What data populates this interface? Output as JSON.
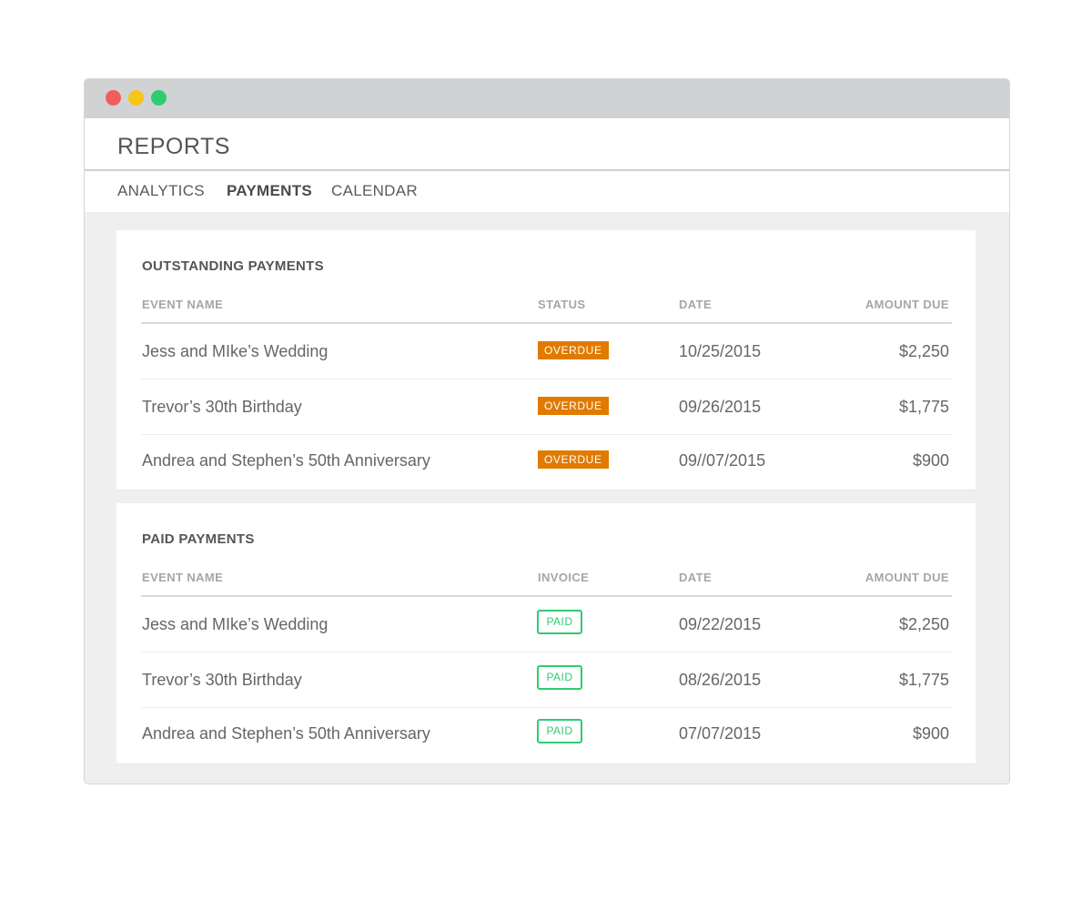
{
  "window": {
    "controls": [
      "close",
      "minimize",
      "maximize"
    ]
  },
  "header": {
    "title": "REPORTS"
  },
  "tabs": [
    {
      "label": "ANALYTICS",
      "active": false
    },
    {
      "label": "PAYMENTS",
      "active": true
    },
    {
      "label": "CALENDAR",
      "active": false
    }
  ],
  "outstanding": {
    "title": "OUTSTANDING PAYMENTS",
    "columns": [
      "EVENT NAME",
      "STATUS",
      "DATE",
      "AMOUNT DUE"
    ],
    "rows": [
      {
        "event": "Jess and MIke’s Wedding",
        "status": "OVERDUE",
        "date": "10/25/2015",
        "amount": "$2,250"
      },
      {
        "event": "Trevor’s 30th Birthday",
        "status": "OVERDUE",
        "date": "09/26/2015",
        "amount": "$1,775"
      },
      {
        "event": "Andrea and Stephen’s 50th Anniversary",
        "status": "OVERDUE",
        "date": "09//07/2015",
        "amount": "$900"
      }
    ]
  },
  "paid": {
    "title": "PAID PAYMENTS",
    "columns": [
      "EVENT NAME",
      "INVOICE",
      "DATE",
      "AMOUNT DUE"
    ],
    "rows": [
      {
        "event": "Jess and MIke’s Wedding",
        "invoice": "PAID",
        "date": "09/22/2015",
        "amount": "$2,250"
      },
      {
        "event": "Trevor’s 30th Birthday",
        "invoice": "PAID",
        "date": "08/26/2015",
        "amount": "$1,775"
      },
      {
        "event": "Andrea and Stephen’s 50th Anniversary",
        "invoice": "PAID",
        "date": "07/07/2015",
        "amount": "$900"
      }
    ]
  },
  "colors": {
    "overdue": "#e07b00",
    "paid": "#2ecc71",
    "close": "#f15d5d",
    "minimize": "#f5c518",
    "maximize": "#2ecc71"
  }
}
